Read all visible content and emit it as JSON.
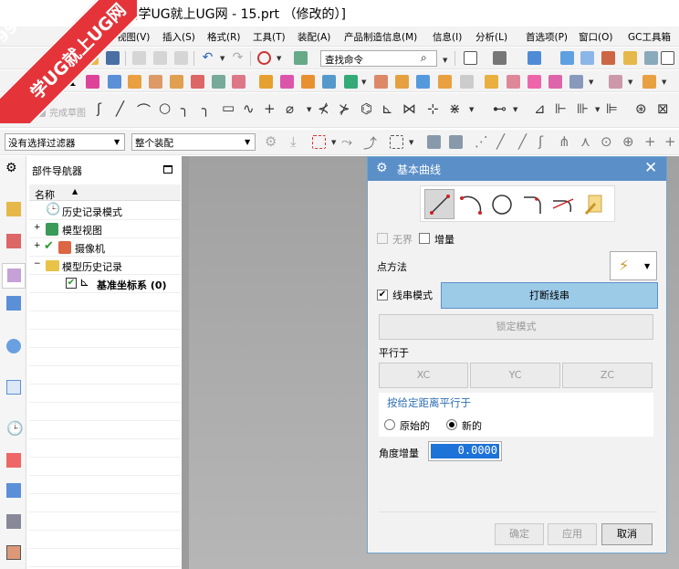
{
  "title": "[学UG就上UG网 - 15.prt （修改的）]",
  "watermark": {
    "small": "9SUG",
    "big": "学UG就上UG网"
  },
  "menu": [
    "视图(V)",
    "插入(S)",
    "格式(R)",
    "工具(T)",
    "装配(A)",
    "产品制造信息(M)",
    "信息(I)",
    "分析(L)",
    "首选项(P)",
    "窗口(O)",
    "GC工具箱"
  ],
  "toolbar": {
    "search_placeholder": "查找命令",
    "finish_sketch": "完成草图",
    "filter_select": "没有选择过滤器",
    "assembly_select": "整个装配"
  },
  "navigator": {
    "title": "部件导航器",
    "column_name": "名称",
    "items": [
      {
        "label": "历史记录模式"
      },
      {
        "label": "模型视图"
      },
      {
        "label": "摄像机"
      },
      {
        "label": "模型历史记录"
      },
      {
        "label": "基准坐标系 (0)"
      }
    ]
  },
  "dialog": {
    "title": "基本曲线",
    "unbounded": "无界",
    "increment": "增量",
    "point_method": "点方法",
    "string_mode": "线串模式",
    "break_string": "打断线串",
    "lock_mode": "锁定模式",
    "parallel_to": "平行于",
    "xc": "XC",
    "yc": "YC",
    "zc": "ZC",
    "parallel_at_distance": "按给定距离平行于",
    "original": "原始的",
    "new": "新的",
    "angle_increment": "角度增量",
    "angle_value": "0.0000",
    "ok": "确定",
    "apply": "应用",
    "cancel": "取消"
  },
  "colors": {
    "dialog_header": "#5b8fc8",
    "active_button": "#9ccbe8",
    "watermark": "#e4343a"
  }
}
